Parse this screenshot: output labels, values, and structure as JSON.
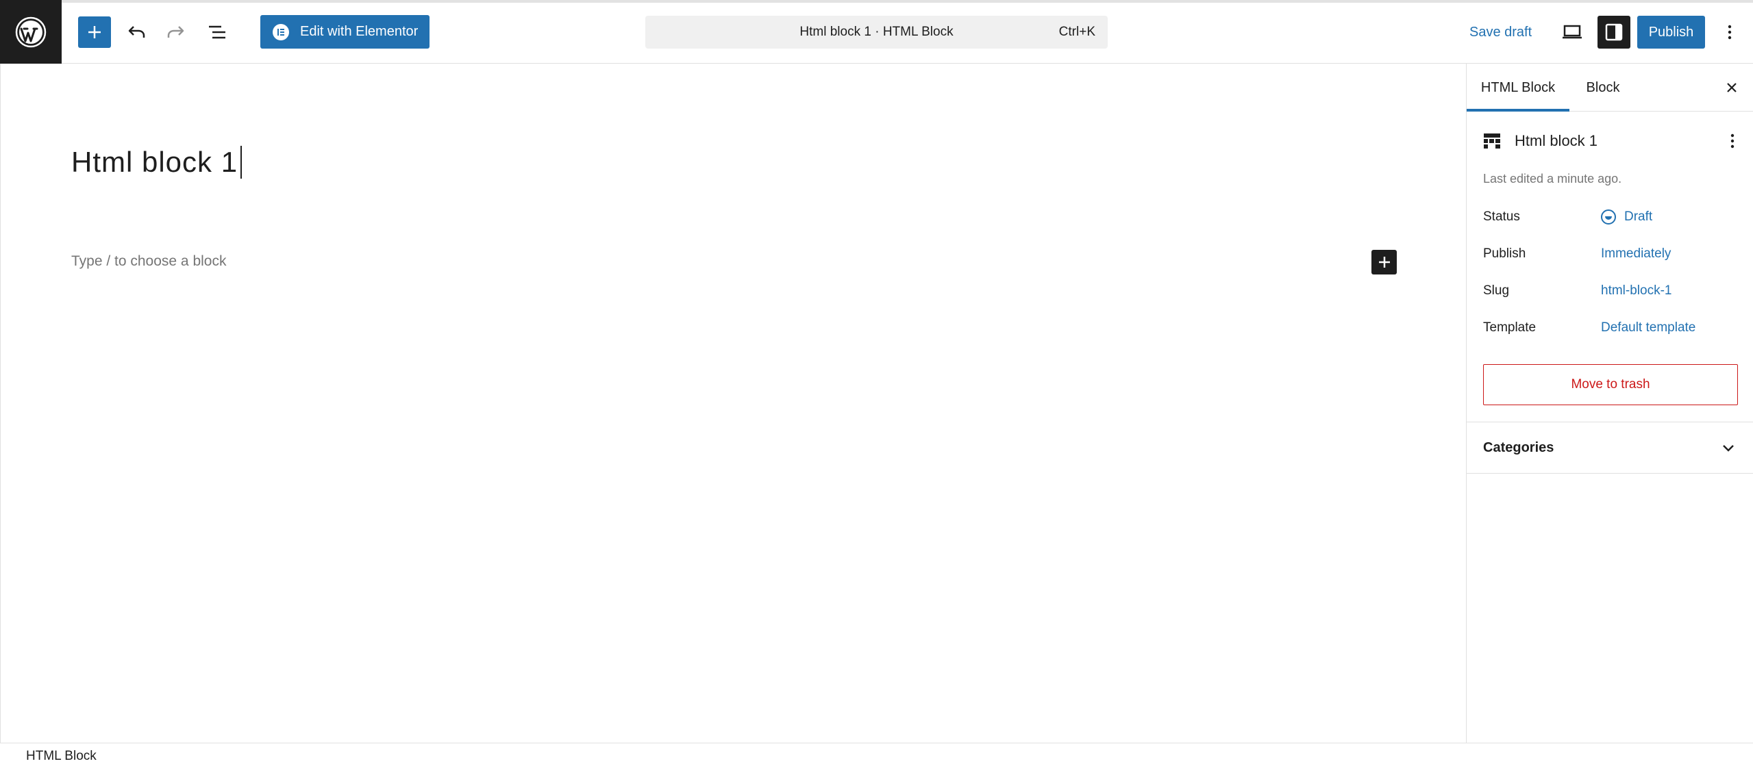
{
  "toolbar": {
    "edit_with_elementor": "Edit with Elementor",
    "doc_title": "Html block 1 · HTML Block",
    "shortcut": "Ctrl+K",
    "save_draft": "Save draft",
    "publish": "Publish"
  },
  "editor": {
    "title": "Html block 1",
    "placeholder": "Type / to choose a block"
  },
  "sidebar": {
    "tabs": [
      "HTML Block",
      "Block"
    ],
    "active_tab": "HTML Block",
    "doc_name": "Html block 1",
    "last_edited": "Last edited a minute ago.",
    "meta": [
      {
        "label": "Status",
        "value": "Draft"
      },
      {
        "label": "Publish",
        "value": "Immediately"
      },
      {
        "label": "Slug",
        "value": "html-block-1"
      },
      {
        "label": "Template",
        "value": "Default template"
      }
    ],
    "trash": "Move to trash",
    "categories": "Categories"
  },
  "footer": {
    "breadcrumb": "HTML Block"
  },
  "colors": {
    "accent": "#2271b1",
    "danger": "#cc1818",
    "dark": "#1e1e1e"
  }
}
